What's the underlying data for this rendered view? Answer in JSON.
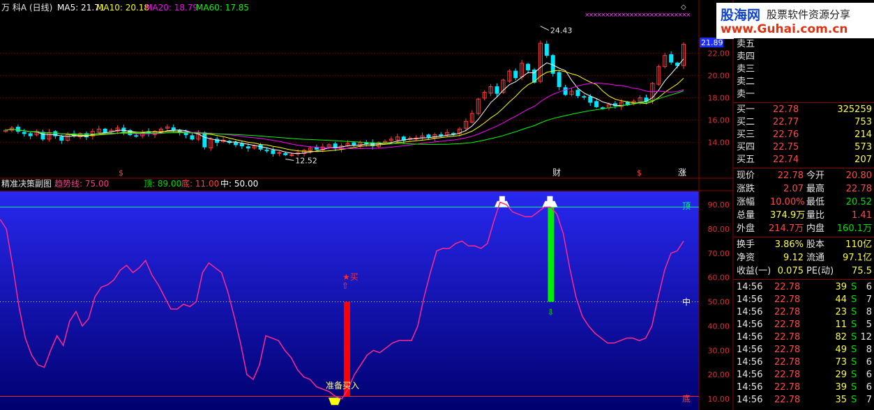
{
  "colors": {
    "up": "#ff3c3c",
    "down": "#00e6ff",
    "ma5": "#ffffff",
    "ma10": "#ffff00",
    "ma20": "#ff00ff",
    "ma60": "#00ff00",
    "indicator_line": "#ff2a8a",
    "buy_bar": "#ff0000",
    "sell_bar": "#00ee00",
    "top_line": "#00ee99",
    "bottom_line": "#ff2020"
  },
  "header": {
    "name": "万 科A",
    "period": "(日线)",
    "ma5": "MA5: 21.71",
    "ma10": "MA10: 20.18",
    "ma20": "MA20: 18.79",
    "ma60": "MA60: 17.85"
  },
  "logo": {
    "site": "股海网",
    "slogan": "股票软件资源分享",
    "url": "www.Guhai.com.cn"
  },
  "price_panel": {
    "current_price_tag": "21.89",
    "max_label": "24.43",
    "min_label": "12.52",
    "markers": [
      "$",
      "财",
      "$",
      "涨"
    ]
  },
  "indicator_header": {
    "name": "精准决策副图",
    "trend": "趋势线: 75.00",
    "top": "顶: 89.00",
    "bottom": "底: 11.00",
    "mid": "中: 50.00"
  },
  "indicator_panel": {
    "label_top": "顶",
    "label_mid": "中",
    "label_bottom": "底",
    "buy_star": "★买",
    "prepare_buy": "准备买入"
  },
  "chart_data": [
    {
      "type": "candlestick",
      "title": "万 科A (日线)",
      "y_ticks": [
        "22.00",
        "20.00",
        "18.00",
        "16.00",
        "14.00"
      ],
      "yrange": [
        11.8,
        24.9
      ],
      "close": [
        15.1,
        15.3,
        15.0,
        14.8,
        14.6,
        15.0,
        14.3,
        14.9,
        14.6,
        14.2,
        14.7,
        14.6,
        14.8,
        14.5,
        15.0,
        15.2,
        14.9,
        15.1,
        15.3,
        15.0,
        14.7,
        14.6,
        14.9,
        14.8,
        15.0,
        15.2,
        15.4,
        15.1,
        14.9,
        14.7,
        14.3,
        14.8,
        13.6,
        14.3,
        14.0,
        14.2,
        14.0,
        13.8,
        13.7,
        13.5,
        13.7,
        13.4,
        13.3,
        13.0,
        13.1,
        12.9,
        12.9,
        13.1,
        13.3,
        13.5,
        13.4,
        13.6,
        13.8,
        13.5,
        13.7,
        13.9,
        13.8,
        14.0,
        13.9,
        13.7,
        14.0,
        14.1,
        14.3,
        14.5,
        14.2,
        14.4,
        14.4,
        14.6,
        14.5,
        14.7,
        14.6,
        14.9,
        14.8,
        15.2,
        15.9,
        16.6,
        17.9,
        18.5,
        19.0,
        18.4,
        19.6,
        20.4,
        19.8,
        21.1,
        20.5,
        19.4,
        22.9,
        21.8,
        20.2,
        19.0,
        18.3,
        18.6,
        18.2,
        18.1,
        17.6,
        17.2,
        17.1,
        17.4,
        17.3,
        17.6,
        17.4,
        17.7,
        18.0,
        17.7,
        19.3,
        20.8,
        21.8,
        21.2,
        20.9,
        22.8
      ],
      "series": [
        {
          "name": "MA5",
          "value": 21.71
        },
        {
          "name": "MA10",
          "value": 20.18
        },
        {
          "name": "MA20",
          "value": 18.79
        },
        {
          "name": "MA60",
          "value": 17.85
        }
      ],
      "annotations": {
        "max": 24.43,
        "min": 12.52,
        "last_price_tag": 21.89
      }
    },
    {
      "type": "line",
      "title": "精准决策副图",
      "y_ticks": [
        "90.00",
        "80.00",
        "70.00",
        "60.00",
        "50.00",
        "40.00",
        "30.00",
        "20.00",
        "10.00"
      ],
      "yrange": [
        6,
        102
      ],
      "series": [
        {
          "name": "趋势线",
          "values": [
            84,
            80,
            65,
            48,
            35,
            28,
            24,
            23,
            30,
            36,
            32,
            42,
            46,
            40,
            43,
            52,
            56,
            57,
            59,
            63,
            65,
            62,
            64,
            67,
            61,
            57,
            52,
            47,
            47,
            49,
            48,
            50,
            62,
            66,
            64,
            62,
            54,
            44,
            33,
            20,
            18,
            24,
            36,
            35,
            34,
            30,
            27,
            22,
            19,
            18,
            15,
            14,
            13,
            11,
            10,
            14,
            20,
            24,
            28,
            30,
            29,
            31,
            33,
            34,
            34,
            34,
            40,
            52,
            62,
            71,
            72,
            72,
            74,
            75,
            73,
            73,
            72,
            74,
            83,
            91,
            90,
            87,
            86,
            85,
            85,
            87,
            89,
            89,
            86,
            78,
            64,
            52,
            44,
            40,
            37,
            35,
            33,
            33,
            34,
            35,
            35,
            34,
            35,
            40,
            52,
            63,
            70,
            71,
            75
          ]
        }
      ],
      "levels": {
        "top": 89,
        "bottom": 11,
        "mid": 50,
        "trend": 75
      },
      "signals": [
        {
          "kind": "buy",
          "index": 53
        },
        {
          "kind": "sell",
          "index": 87
        }
      ]
    }
  ],
  "quote": {
    "ask": [
      {
        "label": "卖五"
      },
      {
        "label": "卖四"
      },
      {
        "label": "卖三"
      },
      {
        "label": "卖二"
      },
      {
        "label": "卖一"
      }
    ],
    "bid": [
      {
        "label": "买一",
        "price": "22.78",
        "vol": "325259"
      },
      {
        "label": "买二",
        "price": "22.77",
        "vol": "753"
      },
      {
        "label": "买三",
        "price": "22.76",
        "vol": "214"
      },
      {
        "label": "买四",
        "price": "22.75",
        "vol": "573"
      },
      {
        "label": "买五",
        "price": "22.74",
        "vol": "207"
      }
    ],
    "stats": [
      {
        "l1": "现价",
        "v1": "22.78",
        "l2": "今开",
        "v2": "20.80"
      },
      {
        "l1": "涨跌",
        "v1": "2.07",
        "l2": "最高",
        "v2": "22.78"
      },
      {
        "l1": "涨幅",
        "v1": "10.00%",
        "l2": "最低",
        "v2": "20.52"
      },
      {
        "l1": "总量",
        "v1": "374.9万",
        "l2": "量比",
        "v2": "1.41"
      },
      {
        "l1": "外盘",
        "v1": "214.7万",
        "l2": "内盘",
        "v2": "160.1万"
      }
    ],
    "stats2": [
      {
        "l1": "换手",
        "v1": "3.86%",
        "l2": "股本",
        "v2": "110亿"
      },
      {
        "l1": "净资",
        "v1": "9.12",
        "l2": "流通",
        "v2": "97.1亿"
      },
      {
        "l1": "收益(一)",
        "v1": "0.075",
        "l2": "PE(动)",
        "v2": "75.5"
      }
    ],
    "ticks": [
      {
        "time": "14:56",
        "price": "22.78",
        "vol": "39",
        "side": "S",
        "n": "6"
      },
      {
        "time": "14:56",
        "price": "22.78",
        "vol": "44",
        "side": "S",
        "n": "7"
      },
      {
        "time": "14:56",
        "price": "22.78",
        "vol": "23",
        "side": "S",
        "n": "8"
      },
      {
        "time": "14:56",
        "price": "22.78",
        "vol": "11",
        "side": "S",
        "n": "5"
      },
      {
        "time": "14:56",
        "price": "22.78",
        "vol": "82",
        "side": "S",
        "n": "12"
      },
      {
        "time": "14:56",
        "price": "22.78",
        "vol": "49",
        "side": "S",
        "n": "8"
      },
      {
        "time": "14:56",
        "price": "22.78",
        "vol": "73",
        "side": "S",
        "n": "6"
      },
      {
        "time": "14:56",
        "price": "22.78",
        "vol": "29",
        "side": "S",
        "n": "6"
      },
      {
        "time": "14:56",
        "price": "22.78",
        "vol": "39",
        "side": "S",
        "n": "6"
      },
      {
        "time": "14:56",
        "price": "22.78",
        "vol": "35",
        "side": "S",
        "n": "7"
      }
    ]
  }
}
